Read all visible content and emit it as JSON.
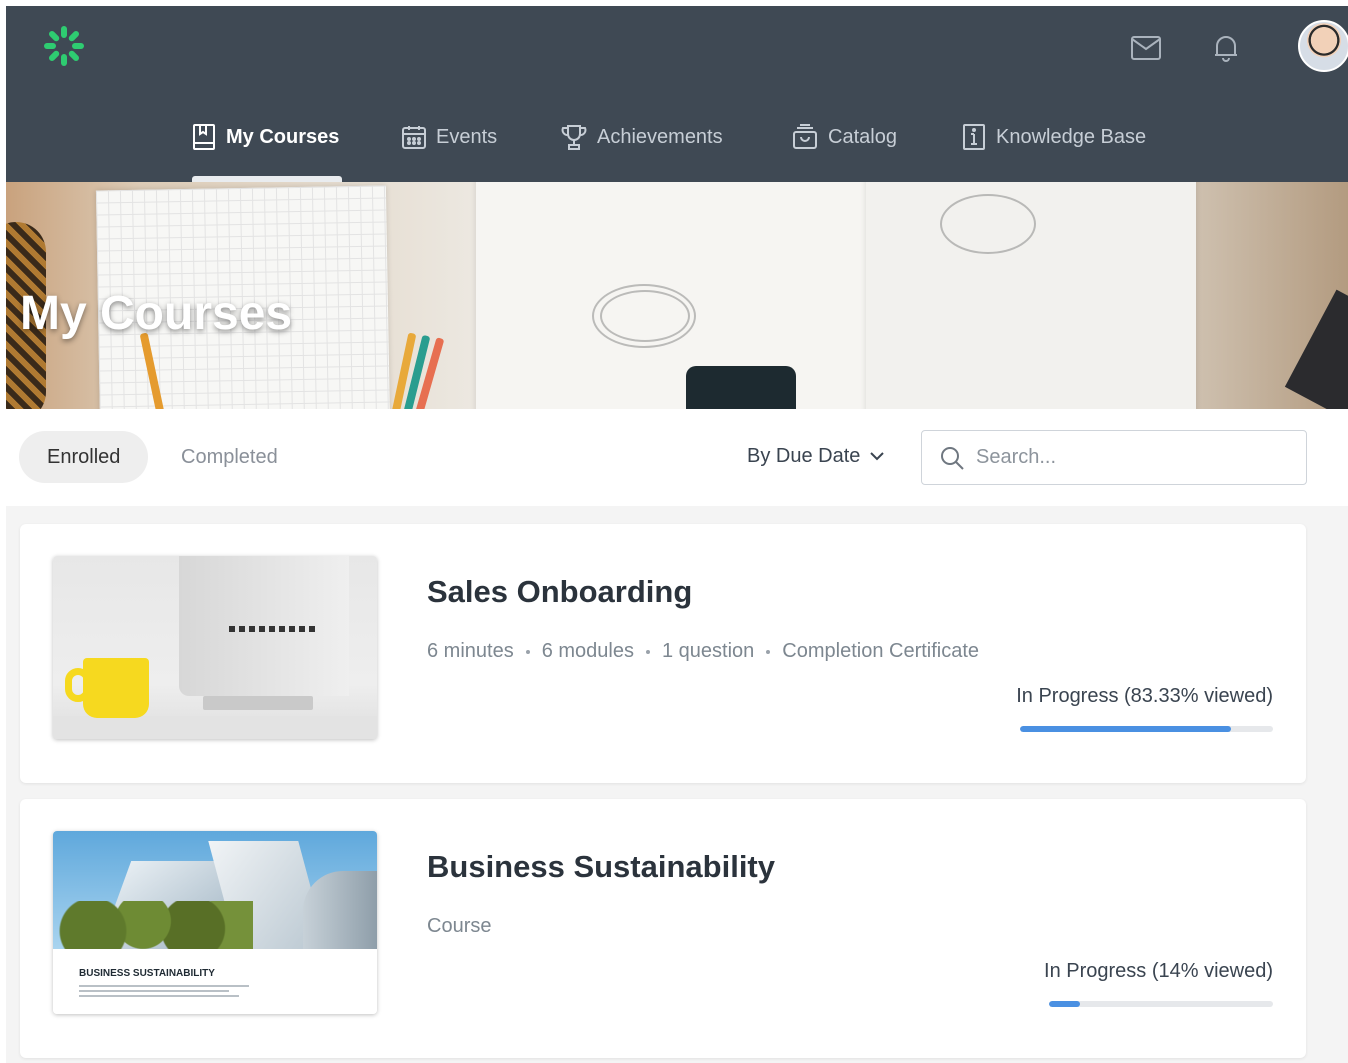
{
  "header": {
    "logo_icon": "asterisk-logo-icon",
    "mail_icon": "mail-icon",
    "bell_icon": "bell-icon",
    "avatar_icon": "user-avatar"
  },
  "nav": {
    "items": [
      {
        "label": "My Courses",
        "icon": "book-icon",
        "active": true
      },
      {
        "label": "Events",
        "icon": "calendar-icon",
        "active": false
      },
      {
        "label": "Achievements",
        "icon": "trophy-icon",
        "active": false
      },
      {
        "label": "Catalog",
        "icon": "inbox-icon",
        "active": false
      },
      {
        "label": "Knowledge Base",
        "icon": "info-icon",
        "active": false
      }
    ]
  },
  "hero": {
    "title": "My Courses"
  },
  "filters": {
    "tabs": [
      {
        "label": "Enrolled",
        "active": true
      },
      {
        "label": "Completed",
        "active": false
      }
    ],
    "sort_label": "By Due Date",
    "search_placeholder": "Search..."
  },
  "courses": [
    {
      "title": "Sales Onboarding",
      "meta": [
        "6 minutes",
        "6 modules",
        "1 question",
        "Completion Certificate"
      ],
      "progress_label": "In Progress (83.33% viewed)",
      "progress": 0.8333
    },
    {
      "title": "Business Sustainability",
      "meta": [
        "Course"
      ],
      "progress_label": "In Progress (14% viewed)",
      "progress": 0.14,
      "thumb_caption": "BUSINESS SUSTAINABILITY"
    }
  ],
  "colors": {
    "header_bg": "#3f4954",
    "accent_green": "#2ecc71",
    "progress_blue": "#4a90e2"
  }
}
